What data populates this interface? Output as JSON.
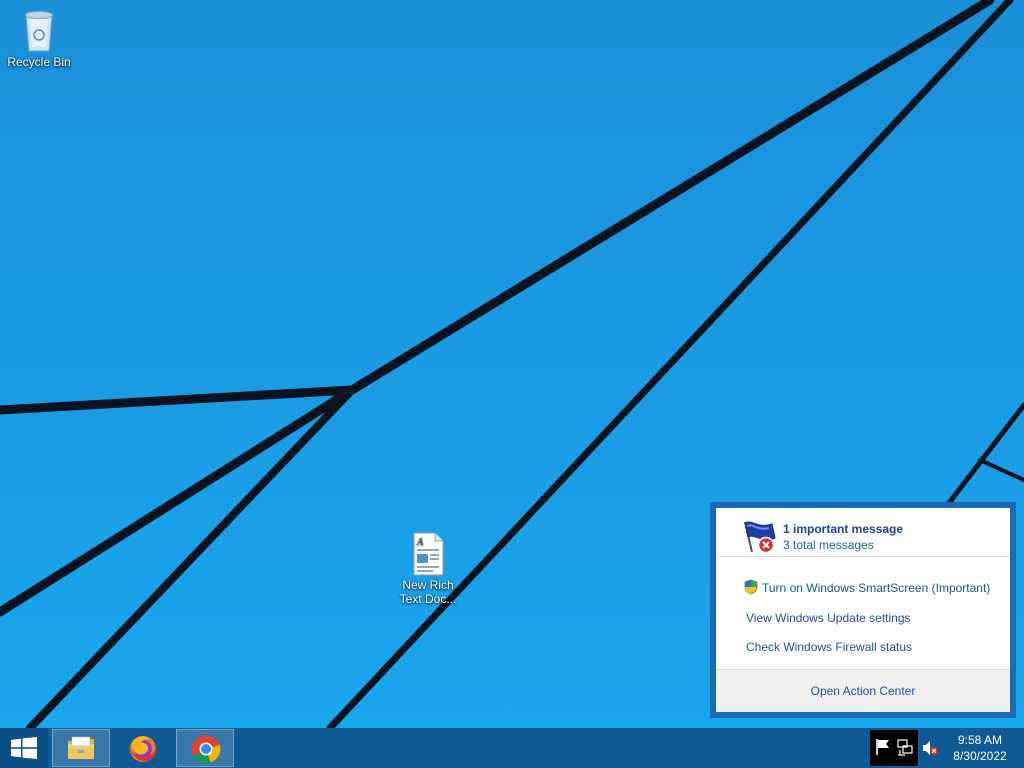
{
  "desktop": {
    "icons": [
      {
        "name": "recycle-bin",
        "label": "Recycle Bin"
      },
      {
        "name": "new-rich-text-document",
        "label": "New Rich\nText Doc..."
      }
    ]
  },
  "action_center": {
    "title": "1 important message",
    "subtitle": "3 total messages",
    "items": [
      {
        "label": "Turn on Windows SmartScreen (Important)"
      },
      {
        "label": "View Windows Update settings"
      },
      {
        "label": "Check Windows Firewall status"
      }
    ],
    "footer_label": "Open Action Center"
  },
  "taskbar": {
    "apps": [
      {
        "name": "file-explorer"
      },
      {
        "name": "firefox"
      },
      {
        "name": "chrome"
      }
    ],
    "clock": {
      "time": "9:58 AM",
      "date": "8/30/2022"
    }
  },
  "colors": {
    "desktop": "#1799e6",
    "taskbar": "#0e5a95",
    "popup_border": "#1a6bb5",
    "link": "#1e4fa8"
  }
}
